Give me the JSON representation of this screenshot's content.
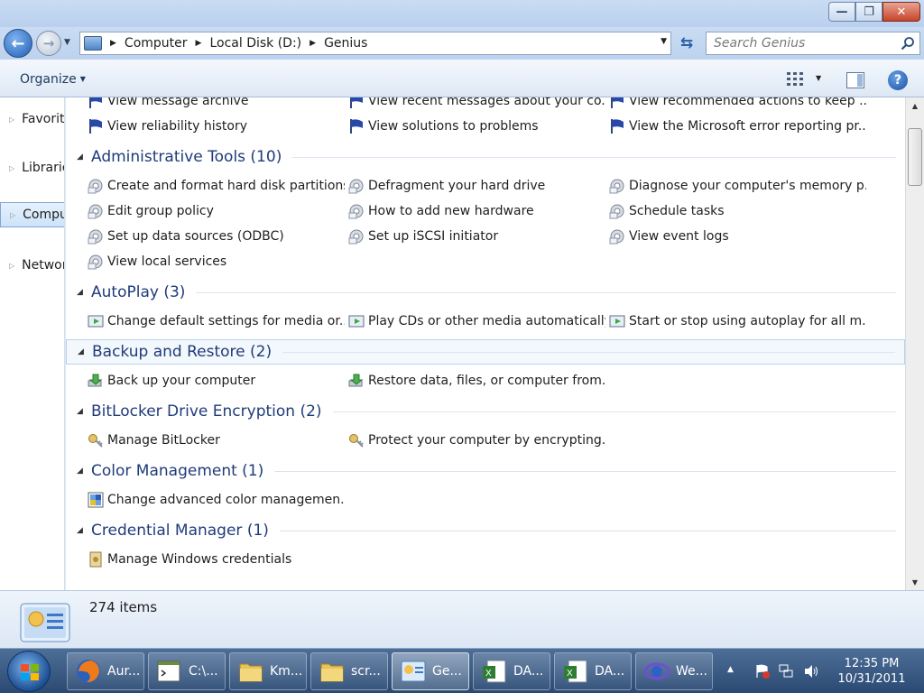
{
  "window": {
    "minimize_label": "—",
    "restore_label": "❐",
    "close_label": "✕"
  },
  "address": {
    "breadcrumbs": [
      "Computer",
      "Local Disk (D:)",
      "Genius"
    ],
    "search_placeholder": "Search Genius"
  },
  "toolbar": {
    "organize_label": "Organize",
    "help_label": "?"
  },
  "nav_pane": {
    "items": [
      {
        "label": "Favorites",
        "icon": "star-icon"
      },
      {
        "label": "Libraries",
        "icon": "libraries-icon"
      },
      {
        "label": "Computer",
        "icon": "computer-icon"
      },
      {
        "label": "Network",
        "icon": "network-icon"
      }
    ]
  },
  "content": {
    "top_items": [
      [
        "View message archive",
        "View recent messages about your co...",
        "View recommended actions to keep ..."
      ],
      [
        "View reliability history",
        "View solutions to problems",
        "View the Microsoft error reporting pr..."
      ]
    ],
    "groups": [
      {
        "title": "Administrative Tools (10)",
        "icon": "admin-tools-icon",
        "rows": [
          [
            "Create and format hard disk partitions",
            "Defragment your hard drive",
            "Diagnose your computer's memory p..."
          ],
          [
            "Edit group policy",
            "How to add new hardware",
            "Schedule tasks"
          ],
          [
            "Set up data sources (ODBC)",
            "Set up iSCSI initiator",
            "View event logs"
          ],
          [
            "View local services"
          ]
        ]
      },
      {
        "title": "AutoPlay (3)",
        "icon": "autoplay-icon",
        "rows": [
          [
            "Change default settings for media or...",
            "Play CDs or other media automatically",
            "Start or stop using autoplay for all m..."
          ]
        ]
      },
      {
        "title": "Backup and Restore (2)",
        "icon": "backup-icon",
        "rows": [
          [
            "Back up your computer",
            "Restore data, files, or computer from..."
          ]
        ]
      },
      {
        "title": "BitLocker Drive Encryption (2)",
        "icon": "bitlocker-key-icon",
        "rows": [
          [
            "Manage BitLocker",
            "Protect your computer by encrypting..."
          ]
        ]
      },
      {
        "title": "Color Management (1)",
        "icon": "color-management-icon",
        "rows": [
          [
            "Change advanced color managemen..."
          ]
        ]
      },
      {
        "title": "Credential Manager (1)",
        "icon": "credential-manager-icon",
        "rows": [
          [
            "Manage Windows credentials"
          ]
        ]
      }
    ]
  },
  "details": {
    "item_count": "274 items"
  },
  "taskbar": {
    "buttons": [
      {
        "label": "Aur...",
        "icon": "firefox-icon"
      },
      {
        "label": "C:\\...",
        "icon": "command-prompt-icon"
      },
      {
        "label": "Km...",
        "icon": "folder-icon"
      },
      {
        "label": "scr...",
        "icon": "folder-icon"
      },
      {
        "label": "Ge...",
        "icon": "control-panel-icon"
      },
      {
        "label": "DA...",
        "icon": "excel-document-icon"
      },
      {
        "label": "DA...",
        "icon": "excel-document-icon"
      },
      {
        "label": "We...",
        "icon": "browser-icon"
      }
    ],
    "clock_time": "12:35 PM",
    "clock_date": "10/31/2011"
  },
  "colors": {
    "group_title": "#1f3b79",
    "taskbar": "#2a4a73",
    "hover_highlight": "#f3f8fd"
  }
}
